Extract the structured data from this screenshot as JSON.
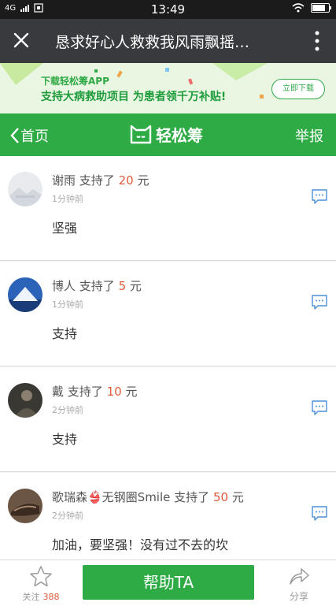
{
  "status_bar": {
    "network": "4G",
    "sim_icon": "sim-card-icon",
    "time": "13:49"
  },
  "title_bar": {
    "title": "恳求好心人救救我风雨飘摇…"
  },
  "banner": {
    "line1": "下载轻松筹APP",
    "line2": "支持大病救助项目  为患者领千万补贴!",
    "download_label": "立即下载"
  },
  "nav": {
    "back_label": "首页",
    "brand": "轻松筹",
    "report_label": "举报"
  },
  "items": [
    {
      "name": "谢雨",
      "supported_prefix": "支持了",
      "amount": "20",
      "unit": "元",
      "time": "1分钟前",
      "message": "坚强"
    },
    {
      "name": "博人",
      "supported_prefix": "支持了",
      "amount": "5",
      "unit": "元",
      "time": "1分钟前",
      "message": "支持"
    },
    {
      "name": "戴",
      "supported_prefix": "支持了",
      "amount": "10",
      "unit": "元",
      "time": "2分钟前",
      "message": "支持"
    },
    {
      "name": "歌瑞森👙无钢圈Smile",
      "supported_prefix": "支持了",
      "amount": "50",
      "unit": "元",
      "time": "2分钟前",
      "message": "加油，要坚强！没有过不去的坎"
    }
  ],
  "footer": {
    "follow_label": "关注",
    "follow_count": "388",
    "help_label": "帮助TA",
    "share_label": "分享"
  },
  "colors": {
    "primary_green": "#2fab45",
    "amount_red": "#e05a3a",
    "title_bar_bg": "#393a3e"
  }
}
